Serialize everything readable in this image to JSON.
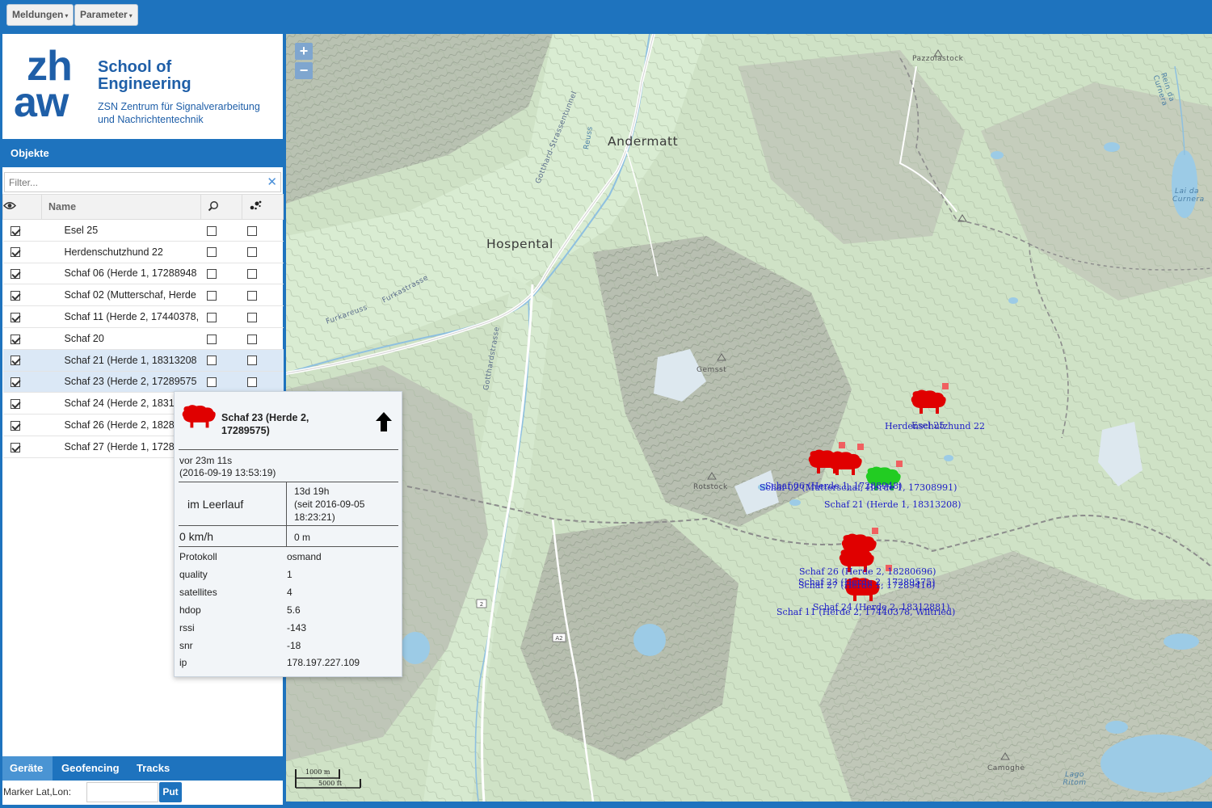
{
  "toolbar": {
    "menus": [
      {
        "label": "Meldungen"
      },
      {
        "label": "Parameter"
      }
    ]
  },
  "logo": {
    "mark_top": "zh",
    "mark_bottom": "aw",
    "school_line1": "School of",
    "school_line2": "Engineering",
    "sub_line1": "ZSN Zentrum für Signalverarbeitung",
    "sub_line2": "und Nachrichtentechnik",
    "color": "#1f5fa8"
  },
  "objects_panel": {
    "title": "Objekte",
    "filter_placeholder": "Filter...",
    "columns": {
      "visible_icon": "eye-icon",
      "name": "Name",
      "search_icon": "search-icon",
      "locate_icon": "paw-icon"
    },
    "rows": [
      {
        "name": "Esel 25",
        "visible": true,
        "search": false,
        "locate": false,
        "selected": false
      },
      {
        "name": "Herdenschutzhund 22",
        "visible": true,
        "search": false,
        "locate": false,
        "selected": false
      },
      {
        "name": "Schaf 06 (Herde 1, 17288948",
        "visible": true,
        "search": false,
        "locate": false,
        "selected": false
      },
      {
        "name": "Schaf 02 (Mutterschaf, Herde",
        "visible": true,
        "search": false,
        "locate": false,
        "selected": false
      },
      {
        "name": "Schaf 11 (Herde 2, 17440378,",
        "visible": true,
        "search": false,
        "locate": false,
        "selected": false
      },
      {
        "name": "Schaf 20",
        "visible": true,
        "search": false,
        "locate": false,
        "selected": false
      },
      {
        "name": "Schaf 21 (Herde 1, 18313208",
        "visible": true,
        "search": false,
        "locate": false,
        "selected": true
      },
      {
        "name": "Schaf 23 (Herde 2, 17289575",
        "visible": true,
        "search": false,
        "locate": false,
        "selected": true
      },
      {
        "name": "Schaf 24 (Herde 2, 1831",
        "visible": true,
        "search": false,
        "locate": false,
        "selected": false
      },
      {
        "name": "Schaf 26 (Herde 2, 1828",
        "visible": true,
        "search": false,
        "locate": false,
        "selected": false
      },
      {
        "name": "Schaf 27 (Herde 1, 1728",
        "visible": true,
        "search": false,
        "locate": false,
        "selected": false
      }
    ]
  },
  "bottom_tabs": [
    {
      "label": "Geräte",
      "active": true
    },
    {
      "label": "Geofencing",
      "active": false
    },
    {
      "label": "Tracks",
      "active": false
    }
  ],
  "marker": {
    "label": "Marker Lat,Lon:",
    "value": "",
    "button": "Put"
  },
  "map": {
    "zoom_in": "+",
    "zoom_out": "−",
    "places": {
      "andermatt": "Andermatt",
      "hospental": "Hospental",
      "pazzolastock": "Pazzolastock",
      "gemsstock": "Gemsst",
      "rotstock": "Rotstock",
      "camoghe": "Camoghè",
      "lai_da_curnera": "Lai da Curnera",
      "lago_ritom": "Lago Ritom",
      "furkareuss": "Furkareuss",
      "furkastrasse": "Furkastrasse",
      "gotthardstrasse": "Gotthardstrasse",
      "gotthard_strassentunnel": "Gotthard-Strassentunnel",
      "reuss": "Reuss",
      "rein_da_curnera": "Rein da Curnera",
      "road_a2": "A2",
      "road_2": "2"
    },
    "markers": [
      {
        "label": "Herdenschutzhund 22",
        "color": "#e00000"
      },
      {
        "label": "Esel 25",
        "color": "#e00000"
      },
      {
        "label": "Schaf 06 (Herde 1, 17288948)",
        "color": "#e00000"
      },
      {
        "label": "Schaf 02 (Mutterschaf, Herde 1, 17308991)",
        "color": "#e00000"
      },
      {
        "label": "Schaf 21 (Herde 1, 18313208)",
        "color": "#22cc22"
      },
      {
        "label": "Schaf 26 (Herde 2, 18280696)",
        "color": "#e00000"
      },
      {
        "label": "Schaf 23 (Herde 2, 17289575)",
        "color": "#e00000"
      },
      {
        "label": "Schaf 27 (Herde 1, 17289416)",
        "color": "#e00000"
      },
      {
        "label": "Schaf 24 (Herde 2, 18312881)",
        "color": "#e00000"
      },
      {
        "label": "Schaf 11 (Herde 2, 17440378, Wiltried)",
        "color": "#e00000"
      }
    ],
    "scale": {
      "metric": "1000 m",
      "imperial": "5000 ft"
    }
  },
  "popup": {
    "title": "Schaf 23 (Herde 2, 17289575)",
    "sheep_color": "#e00000",
    "direction_icon": "arrow-up-icon",
    "ago": "vor 23m 11s",
    "timestamp": "(2016-09-19 13:53:19)",
    "state": "im Leerlauf",
    "duration": "13d 19h",
    "since": "(seit 2016-09-05",
    "since_time": "18:23:21)",
    "speed": "0 km/h",
    "distance": "0 m",
    "attributes": [
      {
        "key": "Protokoll",
        "value": "osmand"
      },
      {
        "key": "quality",
        "value": "1"
      },
      {
        "key": "satellites",
        "value": "4"
      },
      {
        "key": "hdop",
        "value": "5.6"
      },
      {
        "key": "rssi",
        "value": "-143"
      },
      {
        "key": "snr",
        "value": "-18"
      },
      {
        "key": "ip",
        "value": "178.197.227.109"
      }
    ]
  }
}
